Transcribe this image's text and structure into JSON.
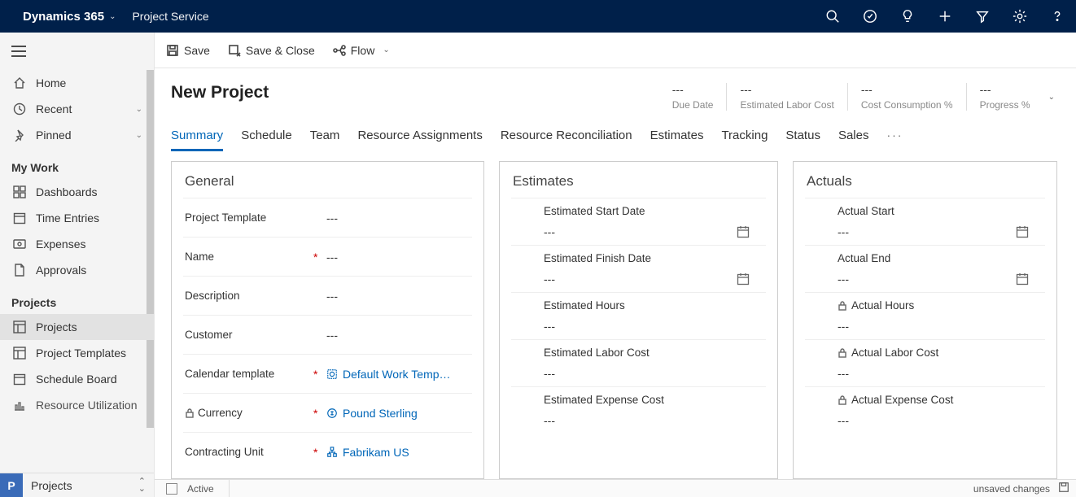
{
  "topbar": {
    "brand": "Dynamics 365",
    "app": "Project Service"
  },
  "sidebar": {
    "home": "Home",
    "recent": "Recent",
    "pinned": "Pinned",
    "section_work": "My Work",
    "dashboards": "Dashboards",
    "time_entries": "Time Entries",
    "expenses": "Expenses",
    "approvals": "Approvals",
    "section_projects": "Projects",
    "projects": "Projects",
    "project_templates": "Project Templates",
    "schedule_board": "Schedule Board",
    "resource_util": "Resource Utilization",
    "bottom_tile": "P",
    "bottom_label": "Projects"
  },
  "cmdbar": {
    "save": "Save",
    "save_close": "Save & Close",
    "flow": "Flow"
  },
  "header": {
    "title": "New Project",
    "metrics": [
      {
        "value": "---",
        "label": "Due Date"
      },
      {
        "value": "---",
        "label": "Estimated Labor Cost"
      },
      {
        "value": "---",
        "label": "Cost Consumption %"
      },
      {
        "value": "---",
        "label": "Progress %"
      }
    ]
  },
  "tabs": [
    "Summary",
    "Schedule",
    "Team",
    "Resource Assignments",
    "Resource Reconciliation",
    "Estimates",
    "Tracking",
    "Status",
    "Sales"
  ],
  "general": {
    "title": "General",
    "project_template_lbl": "Project Template",
    "project_template_val": "---",
    "name_lbl": "Name",
    "name_val": "---",
    "description_lbl": "Description",
    "description_val": "---",
    "customer_lbl": "Customer",
    "customer_val": "---",
    "calendar_lbl": "Calendar template",
    "calendar_val": "Default Work Temp…",
    "currency_lbl": "Currency",
    "currency_val": "Pound Sterling",
    "contracting_lbl": "Contracting Unit",
    "contracting_val": "Fabrikam US"
  },
  "estimates": {
    "title": "Estimates",
    "start_lbl": "Estimated Start Date",
    "start_val": "---",
    "finish_lbl": "Estimated Finish Date",
    "finish_val": "---",
    "hours_lbl": "Estimated Hours",
    "hours_val": "---",
    "labor_lbl": "Estimated Labor Cost",
    "labor_val": "---",
    "expense_lbl": "Estimated Expense Cost",
    "expense_val": "---"
  },
  "actuals": {
    "title": "Actuals",
    "start_lbl": "Actual Start",
    "start_val": "---",
    "end_lbl": "Actual End",
    "end_val": "---",
    "hours_lbl": "Actual Hours",
    "hours_val": "---",
    "labor_lbl": "Actual Labor Cost",
    "labor_val": "---",
    "expense_lbl": "Actual Expense Cost",
    "expense_val": "---"
  },
  "footer": {
    "status": "Active",
    "unsaved": "unsaved changes"
  }
}
